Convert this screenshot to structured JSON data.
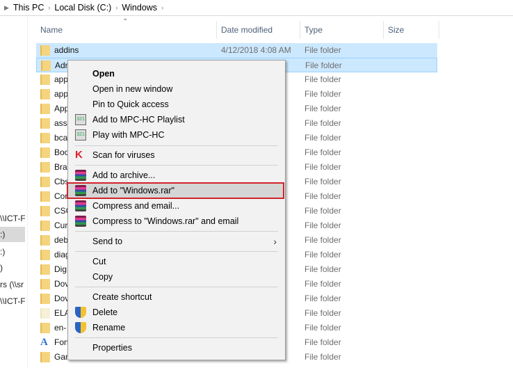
{
  "address": {
    "crumbs": [
      "This PC",
      "Local Disk (C:)",
      "Windows"
    ]
  },
  "nav": [
    "\\\\ICT-F",
    ":)",
    ":)",
    ")",
    "rs (\\\\sr",
    "\\\\ICT-F"
  ],
  "columns": [
    "Name",
    "Date modified",
    "Type",
    "Size"
  ],
  "rows": [
    {
      "name": "addins",
      "date": "4/12/2018 4:08 AM",
      "type": "File folder"
    },
    {
      "name": "AdminArsenal",
      "date": "",
      "type": "File folder"
    },
    {
      "name": "app",
      "date": "",
      "type": "File folder"
    },
    {
      "name": "app",
      "date": "",
      "type": "File folder"
    },
    {
      "name": "App",
      "date": "",
      "type": "File folder"
    },
    {
      "name": "asse",
      "date": "",
      "type": "File folder"
    },
    {
      "name": "bca",
      "date": "",
      "type": "File folder"
    },
    {
      "name": "Boo",
      "date": "",
      "type": "File folder"
    },
    {
      "name": "Bra",
      "date": "",
      "type": "File folder"
    },
    {
      "name": "Cbs",
      "date": "",
      "type": "File folder"
    },
    {
      "name": "Com",
      "date": "",
      "type": "File folder"
    },
    {
      "name": "CSC",
      "date": "",
      "type": "File folder"
    },
    {
      "name": "Cur",
      "date": "",
      "type": "File folder"
    },
    {
      "name": "deb",
      "date": "",
      "type": "File folder"
    },
    {
      "name": "diag",
      "date": "",
      "type": "File folder"
    },
    {
      "name": "Dig",
      "date": "",
      "type": "File folder"
    },
    {
      "name": "Dov",
      "date": "",
      "type": "File folder"
    },
    {
      "name": "Dov",
      "date": "",
      "type": "File folder"
    },
    {
      "name": "ELA",
      "date": "",
      "type": "File folder"
    },
    {
      "name": "en-",
      "date": "",
      "type": "File folder"
    },
    {
      "name": "Fon",
      "date": "",
      "type": "File folder"
    },
    {
      "name": "GameBarPresenceWriter",
      "date": "",
      "type": "File folder"
    }
  ],
  "menu": {
    "open": "Open",
    "open_new": "Open in new window",
    "pin": "Pin to Quick access",
    "mpc_add": "Add to MPC-HC Playlist",
    "mpc_play": "Play with MPC-HC",
    "scan": "Scan for viruses",
    "add_archive": "Add to archive...",
    "add_rar": "Add to \"Windows.rar\"",
    "compress_email": "Compress and email...",
    "compress_rar_email": "Compress to \"Windows.rar\" and email",
    "send_to": "Send to",
    "cut": "Cut",
    "copy": "Copy",
    "create_shortcut": "Create shortcut",
    "delete": "Delete",
    "rename": "Rename",
    "properties": "Properties"
  },
  "colors": {
    "selection": "#cce8ff",
    "highlight_border": "#d2232a",
    "menu_bg": "#f2f2f2"
  }
}
